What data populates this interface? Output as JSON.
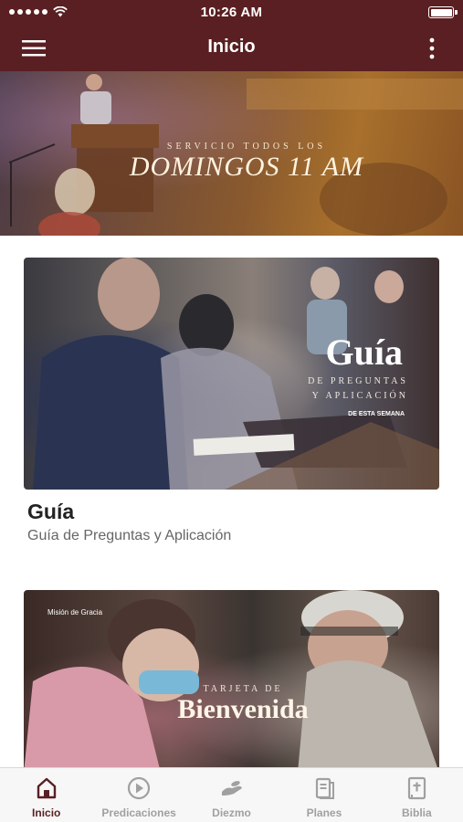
{
  "status_bar": {
    "time": "10:26 AM"
  },
  "nav": {
    "title": "Inicio",
    "menu_icon": "hamburger-icon",
    "more_icon": "more-vertical-icon"
  },
  "hero": {
    "subtitle": "SERVICIO TODOS LOS",
    "title": "DOMINGOS 11 AM"
  },
  "cards": [
    {
      "image_title": "Guía",
      "image_sub1": "DE PREGUNTAS",
      "image_sub2": "Y APLICACIÓN",
      "image_badge": "DE ESTA SEMANA",
      "title": "Guía",
      "description": "Guía de Preguntas y Aplicación"
    },
    {
      "image_brand": "Misión de Gracia",
      "image_sub": "TARJETA DE",
      "image_title": "Bienvenida"
    }
  ],
  "tabs": [
    {
      "label": "Inicio",
      "icon": "home-icon",
      "active": true
    },
    {
      "label": "Predicaciones",
      "icon": "play-circle-icon",
      "active": false
    },
    {
      "label": "Diezmo",
      "icon": "giving-hand-icon",
      "active": false
    },
    {
      "label": "Planes",
      "icon": "reading-plan-icon",
      "active": false
    },
    {
      "label": "Biblia",
      "icon": "bible-icon",
      "active": false
    }
  ],
  "colors": {
    "primary": "#5a1f22",
    "tab_inactive": "#a0a0a0",
    "tab_bg": "#f7f7f7"
  }
}
